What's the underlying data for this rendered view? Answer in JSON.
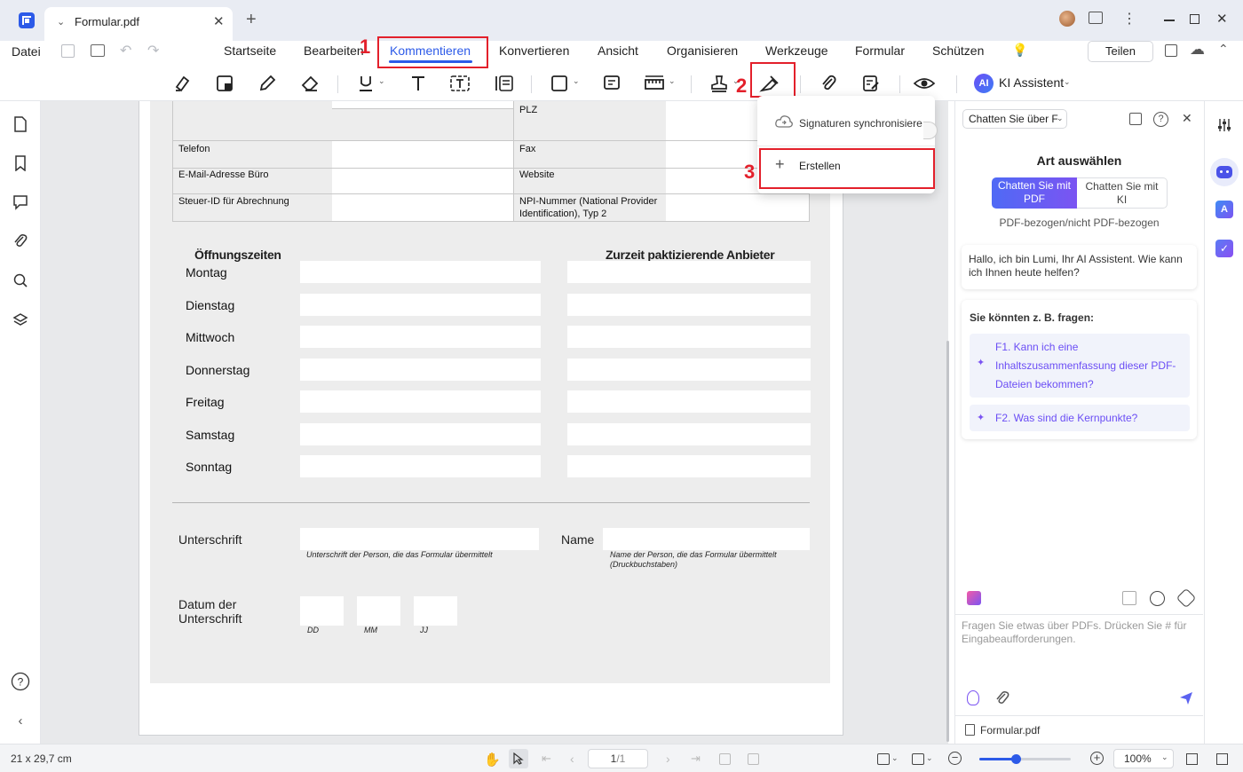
{
  "titlebar": {
    "tab_title": "Formular.pdf",
    "add_tab": "+"
  },
  "menubar": {
    "file": "Datei",
    "items": [
      "Startseite",
      "Bearbeiten",
      "Kommentieren",
      "Konvertieren",
      "Ansicht",
      "Organisieren",
      "Werkzeuge",
      "Formular",
      "Schützen"
    ],
    "share": "Teilen"
  },
  "toolbar": {
    "ai_badge": "AI",
    "ai_label": "KI Assistent"
  },
  "annotations": {
    "n1": "1",
    "n2": "2",
    "n3": "3"
  },
  "dropdown": {
    "sync": "Signaturen synchronisiere",
    "create": "Erstellen"
  },
  "form": {
    "plz": "PLZ",
    "phone": "Telefon",
    "fax": "Fax",
    "email": "E-Mail-Adresse Büro",
    "website": "Website",
    "tax": "Steuer-ID für Abrechnung",
    "npi_line1": "NPI-Nummer (National Provider",
    "npi_line2": "Identification), Typ 2",
    "hours_title": "Öffnungszeiten",
    "providers_title": "Zurzeit paktizierende Anbieter",
    "days": [
      "Montag",
      "Dienstag",
      "Mittwoch",
      "Donnerstag",
      "Freitag",
      "Samstag",
      "Sonntag"
    ],
    "signature": "Unterschrift",
    "signature_hint": "Unterschrift der Person, die das Formular übermittelt",
    "name": "Name",
    "name_hint_1": "Name der Person, die das Formular übermittelt",
    "name_hint_2": "(Druckbuchstaben)",
    "date_line1": "Datum der",
    "date_line2": "Unterschrift",
    "dd": "DD",
    "mm": "MM",
    "yy": "JJ"
  },
  "ai_panel": {
    "dropdown": "Chatten Sie über F",
    "heading": "Art auswählen",
    "toggle_pdf_1": "Chatten Sie mit",
    "toggle_pdf_2": "PDF",
    "toggle_ai_1": "Chatten Sie mit",
    "toggle_ai_2": "KI",
    "sub": "PDF-bezogen/nicht PDF-bezogen",
    "greeting_1": "Hallo, ich bin Lumi, Ihr AI Assistent. Wie kann",
    "greeting_2": "ich Ihnen heute helfen?",
    "suggest_title": "Sie könnten z. B. fragen:",
    "q1_1": "F1. Kann ich eine",
    "q1_2": "Inhaltszusammenfassung dieser PDF-",
    "q1_3": "Dateien bekommen?",
    "q2": "F2. Was sind die Kernpunkte?",
    "input_placeholder_1": "Fragen Sie etwas über PDFs. Drücken Sie # für",
    "input_placeholder_2": "Eingabeaufforderungen.",
    "file": "Formular.pdf"
  },
  "status": {
    "page_size": "21 x 29,7 cm",
    "page_current": "1",
    "page_sep": "/1",
    "zoom": "100%"
  },
  "colors": {
    "accent": "#2c5ae8",
    "annotation_red": "#e3202b",
    "ai_purple": "#6b4ef5"
  }
}
